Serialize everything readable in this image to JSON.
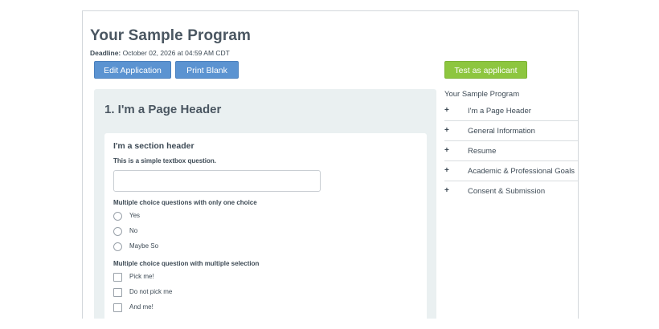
{
  "program": {
    "title": "Your Sample Program",
    "deadline_label": "Deadline:",
    "deadline_value": " October 02, 2026 at 04:59 AM CDT"
  },
  "buttons": {
    "edit": "Edit Application",
    "print": "Print Blank",
    "test": "Test as applicant"
  },
  "colors": {
    "primary_button": "#5b93d1",
    "test_button": "#8dc63f",
    "panel_background": "#eaf0f1"
  },
  "form": {
    "page_header": "1. I'm a Page Header",
    "section_header": "I'm a section header",
    "textbox_question": "This is a simple textbox question.",
    "single_choice_question": "Multiple choice questions with only one choice",
    "single_choice_options": [
      "Yes",
      "No",
      "Maybe So"
    ],
    "multi_choice_question": "Multiple choice question with multiple selection",
    "multi_choice_options": [
      "Pick me!",
      "Do not pick me",
      "And me!"
    ]
  },
  "sidebar": {
    "title": "Your Sample Program",
    "expand_symbol": "+",
    "items": [
      {
        "label": "I'm a Page Header"
      },
      {
        "label": "General Information"
      },
      {
        "label": "Resume"
      },
      {
        "label": "Academic & Professional Goals"
      },
      {
        "label": "Consent & Submission"
      }
    ]
  }
}
